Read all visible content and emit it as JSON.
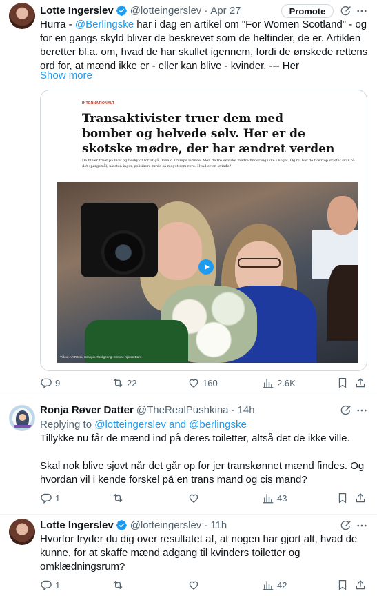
{
  "tweets": [
    {
      "author": "Lotte Ingerslev",
      "handle": "@lotteingerslev",
      "time": "Apr 27",
      "promote_label": "Promote",
      "text_parts": {
        "p1": "Hurra - ",
        "m1": "@Berlingske",
        "p2": " har i dag en artikel om \"For Women Scotland\" - og for en gangs skyld bliver de beskrevet som de heltinder, de er. Artiklen beretter bl.a. om, hvad de har skullet igennem, fordi de ønskede rettens ord for, at mænd ikke er - eller kan blive - kvinder. --- Her"
      },
      "show_more": "Show more",
      "card": {
        "kicker": "INTERNATIONALT",
        "headline": "Transaktivister truer dem med bomber og helvede selv. Her er de skotske mødre, der har ændret verden",
        "lede": "De bliver truet på livet og beskyldt for at gå Donald Trumps ærinde. Men de tre skotske mødre finder sig ikke i noget. Og nu har de tværtop skaffet svar på det spørgsmål, næsten ingen politikere turde så meget som røre: Hvad er en kvinde?",
        "caption": "Video: AP/Ritzau Scanpix. Redigering: Simone Kjølsø-Dam"
      },
      "stats": {
        "replies": "9",
        "reposts": "22",
        "likes": "160",
        "views": "2.6K"
      }
    },
    {
      "author": "Ronja Røver Datter",
      "handle": "@TheRealPushkina",
      "time": "14h",
      "replying_prefix": "Replying to ",
      "replying_to": "@lotteingerslev and @berlingske",
      "text": "Tillykke nu får de mænd ind på deres toiletter, altså det de ikke ville.",
      "text2": "Skal nok blive sjovt når det går op for jer transkønnet mænd findes. Og hvordan vil i kende forskel på en trans mand og cis mand?",
      "stats": {
        "replies": "1",
        "reposts": "",
        "likes": "",
        "views": "43"
      }
    },
    {
      "author": "Lotte Ingerslev",
      "handle": "@lotteingerslev",
      "time": "11h",
      "text": "Hvorfor fryder du dig over resultatet af, at nogen har gjort alt, hvad de kunne, for at skaffe mænd adgang til kvinders toiletter og omklædningsrum?",
      "stats": {
        "replies": "1",
        "reposts": "",
        "likes": "",
        "views": "42"
      }
    }
  ],
  "dot": "·",
  "colors": {
    "accent": "#1d9bf0",
    "muted": "#536471",
    "text": "#0f1419",
    "border": "#cfd9de"
  },
  "icons": [
    "verified-badge-icon",
    "grok-icon",
    "more-icon",
    "reply-icon",
    "repost-icon",
    "like-icon",
    "views-icon",
    "bookmark-icon",
    "share-icon",
    "play-icon"
  ]
}
